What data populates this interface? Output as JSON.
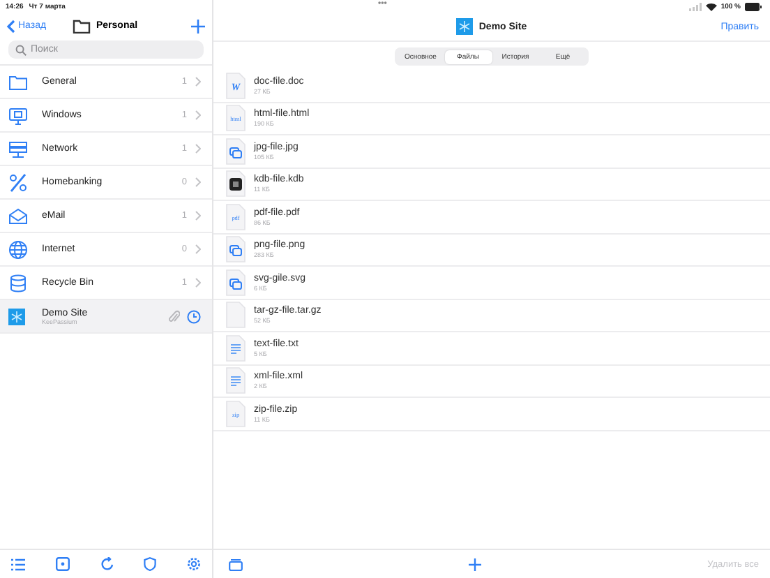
{
  "status_bar": {
    "time": "14:26",
    "date": "Чт 7 марта",
    "dots": "•••",
    "battery": "100 %"
  },
  "sidebar": {
    "back": "Назад",
    "title": "Personal",
    "search": {
      "placeholder": "Поиск"
    },
    "groups": [
      {
        "kind": "folder",
        "name": "General",
        "count": "1"
      },
      {
        "kind": "windows",
        "name": "Windows",
        "count": "1"
      },
      {
        "kind": "network",
        "name": "Network",
        "count": "1"
      },
      {
        "kind": "percent",
        "name": "Homebanking",
        "count": "0"
      },
      {
        "kind": "email",
        "name": "eMail",
        "count": "1"
      },
      {
        "kind": "globe",
        "name": "Internet",
        "count": "0"
      },
      {
        "kind": "bin",
        "name": "Recycle Bin",
        "count": "1"
      }
    ],
    "entries": [
      {
        "title": "Demo Site",
        "subtitle": "KeePassium",
        "selected": true,
        "has_attachment": true,
        "has_expiry": true
      }
    ]
  },
  "detail": {
    "title": "Demo Site",
    "edit": "Править",
    "tabs": [
      {
        "label": "Основное",
        "selected": false
      },
      {
        "label": "Файлы",
        "selected": true
      },
      {
        "label": "История",
        "selected": false
      },
      {
        "label": "Ещё",
        "selected": false
      }
    ],
    "files": [
      {
        "kind": "word",
        "badge": "W",
        "name": "doc-file.doc",
        "size": "27 КБ"
      },
      {
        "kind": "html",
        "badge": "html",
        "name": "html-file.html",
        "size": "190 КБ"
      },
      {
        "kind": "image",
        "name": "jpg-file.jpg",
        "size": "105 КБ"
      },
      {
        "kind": "kdb",
        "name": "kdb-file.kdb",
        "size": "11 КБ"
      },
      {
        "kind": "pdf",
        "badge": "pdf",
        "name": "pdf-file.pdf",
        "size": "86 КБ"
      },
      {
        "kind": "image",
        "name": "png-file.png",
        "size": "283 КБ"
      },
      {
        "kind": "image",
        "name": "svg-gile.svg",
        "size": "6 КБ"
      },
      {
        "kind": "blank",
        "name": "tar-gz-file.tar.gz",
        "size": "52 КБ"
      },
      {
        "kind": "text",
        "name": "text-file.txt",
        "size": "5 КБ"
      },
      {
        "kind": "text",
        "name": "xml-file.xml",
        "size": "2 КБ"
      },
      {
        "kind": "zip",
        "badge": "zip",
        "name": "zip-file.zip",
        "size": "11 КБ"
      }
    ],
    "delete_all": {
      "label": "Удалить все",
      "disabled": true
    }
  }
}
